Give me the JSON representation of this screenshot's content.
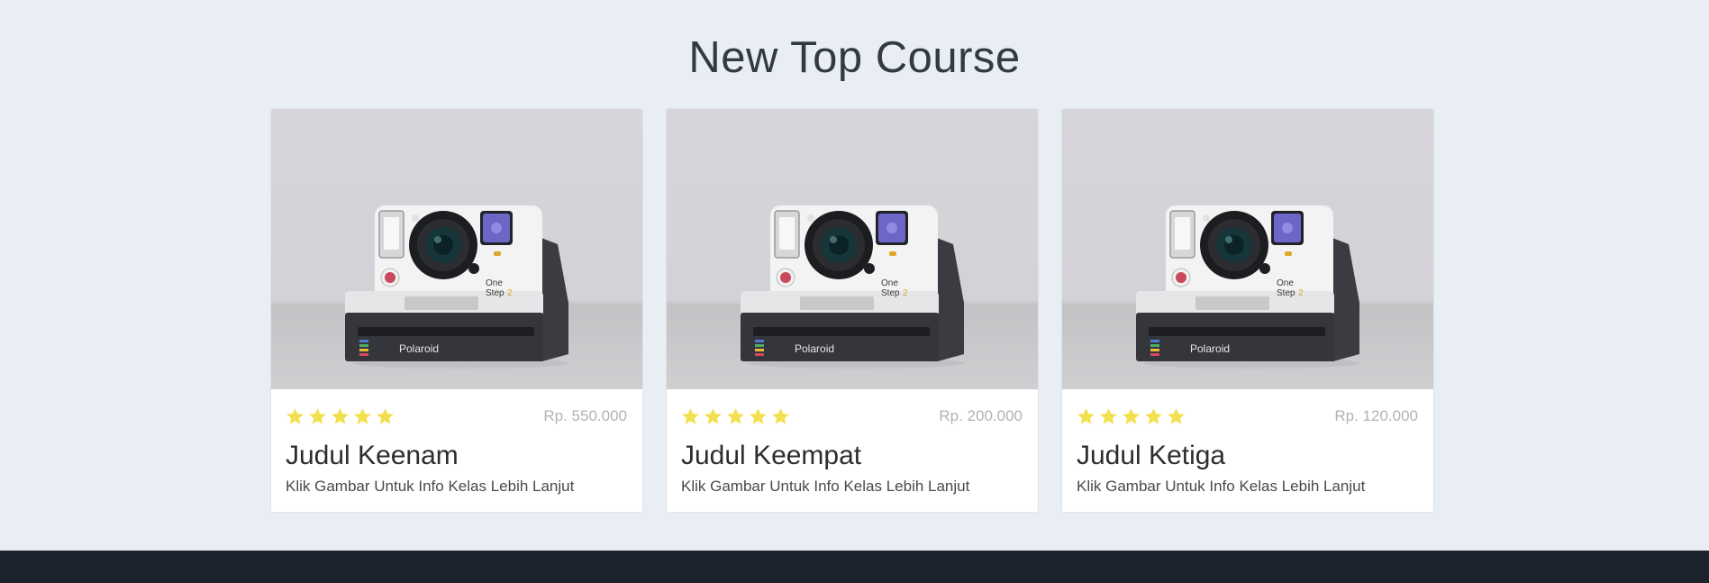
{
  "section": {
    "title": "New Top Course"
  },
  "courses": [
    {
      "rating": 5,
      "price": "Rp. 550.000",
      "title": "Judul Keenam",
      "description": "Klik Gambar Untuk Info Kelas Lebih Lanjut",
      "image_icon": "instant-camera-photo",
      "camera_brand": "Polaroid",
      "camera_model": "One Step 2"
    },
    {
      "rating": 5,
      "price": "Rp. 200.000",
      "title": "Judul Keempat",
      "description": "Klik Gambar Untuk Info Kelas Lebih Lanjut",
      "image_icon": "instant-camera-photo",
      "camera_brand": "Polaroid",
      "camera_model": "One Step 2"
    },
    {
      "rating": 5,
      "price": "Rp. 120.000",
      "title": "Judul Ketiga",
      "description": "Klik Gambar Untuk Info Kelas Lebih Lanjut",
      "image_icon": "instant-camera-photo",
      "camera_brand": "Polaroid",
      "camera_model": "One Step 2"
    }
  ],
  "colors": {
    "page_background": "#e9edf4",
    "footer_background": "#1d232c",
    "star": "#f2e04e",
    "price_text": "#b3b3b3"
  }
}
